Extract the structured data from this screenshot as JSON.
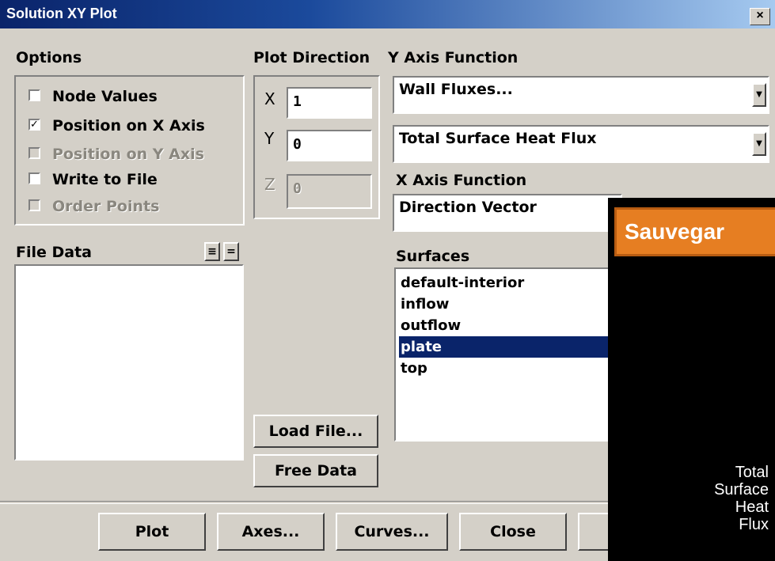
{
  "window": {
    "title": "Solution XY Plot",
    "close_glyph": "×"
  },
  "options": {
    "heading": "Options",
    "items": [
      {
        "label": "Node Values",
        "checked": false,
        "enabled": true
      },
      {
        "label": "Position on X Axis",
        "checked": true,
        "enabled": true
      },
      {
        "label": "Position on Y Axis",
        "checked": false,
        "enabled": false
      },
      {
        "label": "Write to File",
        "checked": false,
        "enabled": true
      },
      {
        "label": "Order Points",
        "checked": false,
        "enabled": false
      }
    ],
    "check_glyph": "✓"
  },
  "plot_direction": {
    "heading": "Plot Direction",
    "x": {
      "label": "X",
      "value": "1"
    },
    "y": {
      "label": "Y",
      "value": "0"
    },
    "z": {
      "label": "Z",
      "value": "0"
    }
  },
  "y_axis": {
    "heading": "Y Axis Function",
    "category": "Wall Fluxes...",
    "function": "Total Surface Heat Flux"
  },
  "x_axis": {
    "heading": "X Axis Function",
    "function": "Direction Vector"
  },
  "file_data": {
    "heading": "File Data",
    "btn_select_all": "≡",
    "btn_deselect": "="
  },
  "surfaces": {
    "heading": "Surfaces",
    "items": [
      "default-interior",
      "inflow",
      "outflow",
      "plate",
      "top"
    ],
    "selected": "plate"
  },
  "buttons": {
    "load_file": "Load File...",
    "free_data": "Free Data",
    "plot": "Plot",
    "axes": "Axes...",
    "curves": "Curves...",
    "close": "Close"
  },
  "overlay": {
    "banner": "Sauvegar",
    "lines": [
      "Total",
      "Surface",
      "Heat",
      "Flux"
    ]
  },
  "colors": {
    "selection": "#0a246a",
    "banner": "#e67e22",
    "title_bar": "#0a246a"
  }
}
